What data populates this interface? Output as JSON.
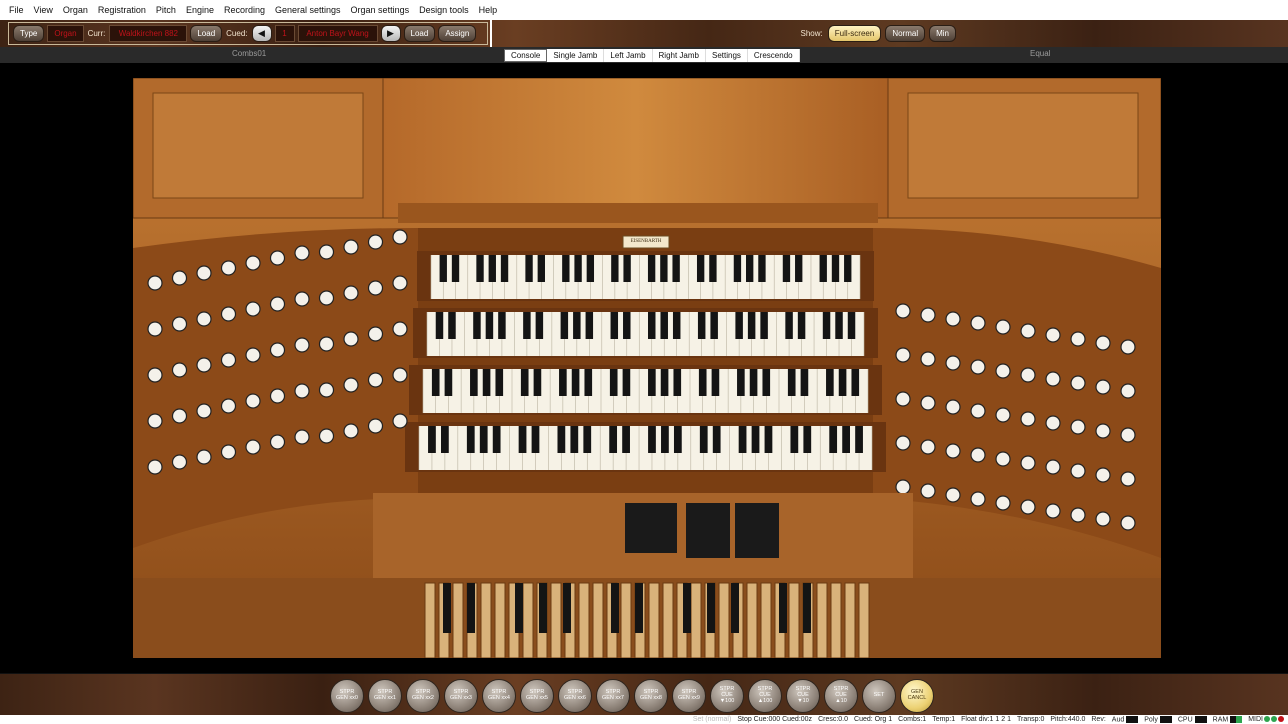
{
  "menu": [
    "File",
    "View",
    "Organ",
    "Registration",
    "Pitch",
    "Engine",
    "Recording",
    "General settings",
    "Organ settings",
    "Design tools",
    "Help"
  ],
  "toolbar": {
    "type_btn": "Type",
    "organ_btn": "Organ",
    "curr_label": "Curr:",
    "current_organ": "Waldkirchen 882",
    "load_btn": "Load",
    "cued_label": "Cued:",
    "cued_number": "1",
    "cued_organ": "Anton Bayr Wang",
    "load2_btn": "Load",
    "assign_btn": "Assign",
    "show_label": "Show:",
    "show_options": [
      "Full-screen",
      "Normal",
      "Min"
    ],
    "show_selected": "Full-screen"
  },
  "tabrow": {
    "left_text": "Combs01",
    "right_text": "Equal",
    "tabs": [
      "Console",
      "Single Jamb",
      "Left Jamb",
      "Right Jamb",
      "Settings",
      "Crescendo"
    ],
    "active_tab": "Console"
  },
  "console": {
    "builder_plate": "EISENBARTH",
    "manual_count": 4
  },
  "pistons": [
    {
      "l1": "STPR",
      "l2": "GEN xx0"
    },
    {
      "l1": "STPR",
      "l2": "GEN xx1"
    },
    {
      "l1": "STPR",
      "l2": "GEN xx2"
    },
    {
      "l1": "STPR",
      "l2": "GEN xx3"
    },
    {
      "l1": "STPR",
      "l2": "GEN xx4"
    },
    {
      "l1": "STPR",
      "l2": "GEN xx5"
    },
    {
      "l1": "STPR",
      "l2": "GEN xx6"
    },
    {
      "l1": "STPR",
      "l2": "GEN xx7"
    },
    {
      "l1": "STPR",
      "l2": "GEN xx8"
    },
    {
      "l1": "STPR",
      "l2": "GEN xx9"
    },
    {
      "l1": "STPR",
      "l2": "CUE",
      "l3": "▼100"
    },
    {
      "l1": "STPR",
      "l2": "CUE",
      "l3": "▲100"
    },
    {
      "l1": "STPR",
      "l2": "CUE",
      "l3": "▼10"
    },
    {
      "l1": "STPR",
      "l2": "CUE",
      "l3": "▲10"
    },
    {
      "l1": "SET",
      "l2": ""
    },
    {
      "l1": "GEN",
      "l2": "CANCL"
    }
  ],
  "status": {
    "set_label": "Set (normal)",
    "stop_cue": "Stop Cue:000 Cued:00z",
    "cresc": "Cresc:0.0",
    "cued_org": "Cued: Org 1",
    "combs": "Combs:1",
    "temp": "Temp:1",
    "float_div": "Float div:1 1 2 1",
    "transp": "Transp:0",
    "pitch": "Pitch:440.0",
    "rev": "Rev:",
    "audio_label": "Aud",
    "poly_label": "Poly",
    "cpu_label": "CPU",
    "ram_label": "RAM",
    "midi_label": "MIDI"
  },
  "colors": {
    "wood_dark": "#3d2314",
    "status_red": "#c2121a",
    "gold": "#ecd173"
  }
}
